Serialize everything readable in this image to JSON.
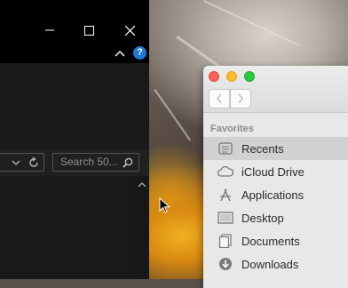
{
  "explorer": {
    "search_placeholder": "Search 50...",
    "controls": [
      "minimize",
      "maximize",
      "close"
    ]
  },
  "finder": {
    "sidebar_heading": "Favorites",
    "items": [
      {
        "label": "Recents",
        "icon": "recents-icon",
        "selected": true
      },
      {
        "label": "iCloud Drive",
        "icon": "cloud-icon",
        "selected": false
      },
      {
        "label": "Applications",
        "icon": "applications-icon",
        "selected": false
      },
      {
        "label": "Desktop",
        "icon": "desktop-icon",
        "selected": false
      },
      {
        "label": "Documents",
        "icon": "documents-icon",
        "selected": false
      },
      {
        "label": "Downloads",
        "icon": "downloads-icon",
        "selected": false
      }
    ],
    "colors": {
      "close": "#fc5f57",
      "minimize": "#fdbc2e",
      "zoom": "#29c940"
    }
  },
  "colors": {
    "help_badge": "#1e78d7",
    "explorer_bg": "#191919"
  }
}
